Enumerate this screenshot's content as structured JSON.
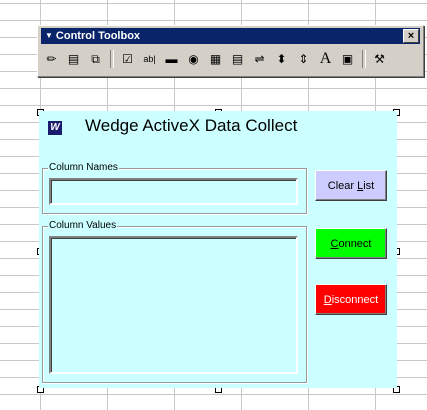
{
  "toolbox": {
    "title": "Control Toolbox",
    "close": "×",
    "icons": [
      {
        "name": "design-mode-icon",
        "glyph": "✏"
      },
      {
        "name": "properties-icon",
        "glyph": "▤"
      },
      {
        "name": "view-code-icon",
        "glyph": "⧉"
      },
      {
        "name": "checkbox-icon",
        "glyph": "☑"
      },
      {
        "name": "textbox-icon",
        "glyph": "ab|"
      },
      {
        "name": "command-button-icon",
        "glyph": "▬"
      },
      {
        "name": "option-button-icon",
        "glyph": "◉"
      },
      {
        "name": "listbox-icon",
        "glyph": "▦"
      },
      {
        "name": "combobox-icon",
        "glyph": "▤"
      },
      {
        "name": "toggle-button-icon",
        "glyph": "⇌"
      },
      {
        "name": "spin-button-icon",
        "glyph": "⬍"
      },
      {
        "name": "scrollbar-icon",
        "glyph": "⇕"
      },
      {
        "name": "label-icon",
        "glyph": "A"
      },
      {
        "name": "image-icon",
        "glyph": "▣"
      },
      {
        "name": "more-controls-icon",
        "glyph": "⚒"
      }
    ]
  },
  "form": {
    "title": "Wedge ActiveX Data Collect",
    "logo": "W",
    "column_names_label": "Column Names",
    "column_values_label": "Column Values",
    "clear_list_pre": "Clear ",
    "clear_list_key": "L",
    "clear_list_post": "ist",
    "connect_key": "C",
    "connect_post": "onnect",
    "disconnect_key": "D",
    "disconnect_post": "isconnect",
    "colors": {
      "form_bg": "#ccffff",
      "clear_list_bg": "#ccccff",
      "connect_bg": "#00ff00",
      "disconnect_bg": "#ff0000",
      "disconnect_fg": "#ffffff"
    }
  }
}
